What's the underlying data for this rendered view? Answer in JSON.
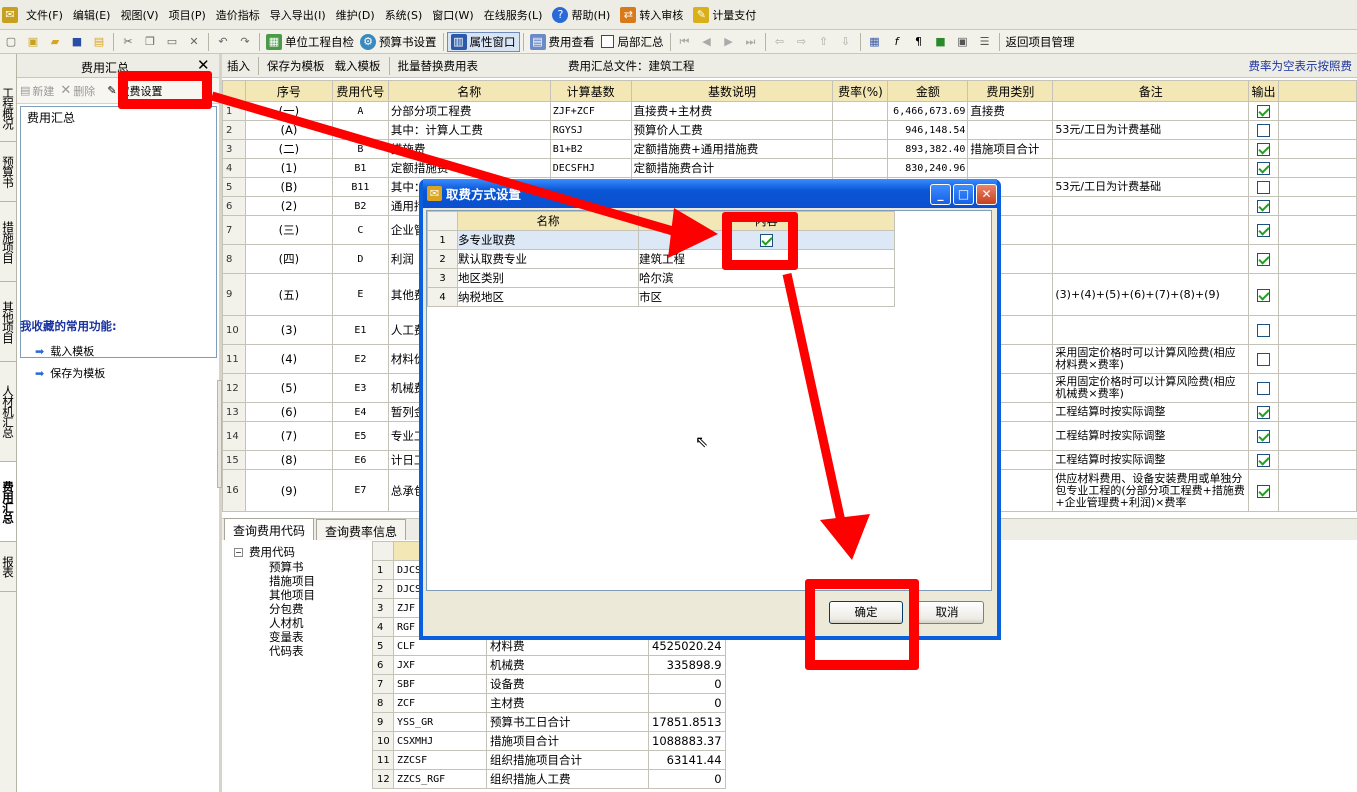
{
  "menubar": {
    "items": [
      "文件(F)",
      "编辑(E)",
      "视图(V)",
      "项目(P)",
      "造价指标",
      "导入导出(I)",
      "维护(D)",
      "系统(S)",
      "窗口(W)",
      "在线服务(L)",
      "帮助(H)",
      "转入审核",
      "计量支付"
    ]
  },
  "toolbar": {
    "unit_check": "单位工程自检",
    "budget_settings": "预算书设置",
    "property_window": "属性窗口",
    "fee_view": "费用查看",
    "partial_summary": "局部汇总",
    "back_to_project": "返回项目管理"
  },
  "vtabs": [
    "工程概况",
    "预算书",
    "措施项目",
    "其他项目",
    "人材机汇总",
    "费用汇总",
    "报表"
  ],
  "left_panel": {
    "title": "费用汇总",
    "new": "新建",
    "delete": "删除",
    "fee_setting": "取费设置",
    "tree_item": "费用汇总",
    "favorites_title": "我收藏的常用功能:",
    "favorites": [
      "载入模板",
      "保存为模板"
    ]
  },
  "main_toolbar": {
    "insert": "插入",
    "save_template": "保存为模板",
    "load_template": "载入模板",
    "batch_replace": "批量替换费用表",
    "summary_file": "费用汇总文件：建筑工程",
    "rate_hint": "费率为空表示按照费"
  },
  "grid": {
    "headers": [
      "序号",
      "费用代号",
      "名称",
      "计算基数",
      "基数说明",
      "费率(%)",
      "金额",
      "费用类别",
      "备注",
      "输出"
    ],
    "rows": [
      {
        "n": "1",
        "seq": "(一)",
        "code": "A",
        "name": "分部分项工程费",
        "base": "ZJF+ZCF",
        "desc": "直接费+主材费",
        "rate": "",
        "amount": "6,466,673.69",
        "cat": "直接费",
        "note": "",
        "out": true
      },
      {
        "n": "2",
        "seq": "(A)",
        "code": "",
        "name": "其中：计算人工费",
        "base": "RGYSJ",
        "desc": "预算价人工费",
        "rate": "",
        "amount": "946,148.54",
        "cat": "",
        "note": "53元/工日为计费基础",
        "out": false
      },
      {
        "n": "3",
        "seq": "(二)",
        "code": "B",
        "name": "措施费",
        "base": "B1+B2",
        "desc": "定额措施费+通用措施费",
        "rate": "",
        "amount": "893,382.40",
        "cat": "措施项目合计",
        "note": "",
        "out": true
      },
      {
        "n": "4",
        "seq": "(1)",
        "code": "B1",
        "name": "定额措施费",
        "base": "DECSFHJ",
        "desc": "定额措施费合计",
        "rate": "",
        "amount": "830,240.96",
        "cat": "",
        "note": "",
        "out": true
      },
      {
        "n": "5",
        "seq": "(B)",
        "code": "B11",
        "name": "其中：计算",
        "base": "",
        "desc": "",
        "rate": "",
        "amount": "",
        "cat": "",
        "note": "53元/工日为计费基础",
        "out": false
      },
      {
        "n": "6",
        "seq": "(2)",
        "code": "B2",
        "name": "通用措施费",
        "base": "",
        "desc": "",
        "rate": "",
        "amount": "",
        "cat": "",
        "note": "",
        "out": true
      },
      {
        "n": "7",
        "seq": "(三)",
        "code": "C",
        "name": "企业管理费",
        "base": "",
        "desc": "",
        "rate": "",
        "amount": "",
        "cat": "",
        "note": "",
        "out": true
      },
      {
        "n": "8",
        "seq": "(四)",
        "code": "D",
        "name": "利润",
        "base": "",
        "desc": "",
        "rate": "",
        "amount": "",
        "cat": "",
        "note": "",
        "out": true
      },
      {
        "n": "9",
        "seq": "(五)",
        "code": "E",
        "name": "其他费用",
        "base": "",
        "desc": "",
        "rate": "",
        "amount": "",
        "cat": "",
        "note": "(3)+(4)+(5)+(6)+(7)+(8)+(9)",
        "out": true
      },
      {
        "n": "10",
        "seq": "(3)",
        "code": "E1",
        "name": "人工费价差",
        "base": "",
        "desc": "",
        "rate": "",
        "amount": "",
        "cat": "",
        "note": "",
        "out": false
      },
      {
        "n": "11",
        "seq": "(4)",
        "code": "E2",
        "name": "材料价差",
        "base": "",
        "desc": "",
        "rate": "",
        "amount": "",
        "cat": "",
        "note": "采用固定价格时可以计算风险费(相应材料费×费率)",
        "out": false
      },
      {
        "n": "12",
        "seq": "(5)",
        "code": "E3",
        "name": "机械费价差",
        "base": "",
        "desc": "",
        "rate": "",
        "amount": "",
        "cat": "",
        "note": "采用固定价格时可以计算风险费(相应机械费×费率)",
        "out": false
      },
      {
        "n": "13",
        "seq": "(6)",
        "code": "E4",
        "name": "暂列金额",
        "base": "",
        "desc": "",
        "rate": "",
        "amount": "",
        "cat": "",
        "note": "工程结算时按实际调整",
        "out": true
      },
      {
        "n": "14",
        "seq": "(7)",
        "code": "E5",
        "name": "专业工程暂估价",
        "base": "",
        "desc": "",
        "rate": "",
        "amount": "",
        "cat": "",
        "note": "工程结算时按实际调整",
        "out": true
      },
      {
        "n": "15",
        "seq": "(8)",
        "code": "E6",
        "name": "计日工",
        "base": "",
        "desc": "",
        "rate": "",
        "amount": "",
        "cat": "",
        "note": "工程结算时按实际调整",
        "out": true
      },
      {
        "n": "16",
        "seq": "(9)",
        "code": "E7",
        "name": "总承包服务费",
        "base": "",
        "desc": "",
        "rate": "",
        "amount": "",
        "cat": "",
        "note": "供应材料费用、设备安装费用或单独分包专业工程的(分部分项工程费+措施费+企业管理费+利润)×费率",
        "out": true
      }
    ]
  },
  "bottom_tabs": [
    "查询费用代码",
    "查询费率信息"
  ],
  "code_tree": {
    "root": "费用代码",
    "children": [
      "预算书",
      "措施项目",
      "其他项目",
      "分包费",
      "人材机",
      "变量表",
      "代码表"
    ]
  },
  "code_grid": {
    "rows": [
      {
        "n": "1",
        "code": "DJCS",
        "name": "",
        "value": ""
      },
      {
        "n": "2",
        "code": "DJCS",
        "name": "",
        "value": ""
      },
      {
        "n": "3",
        "code": "ZJF",
        "name": "",
        "value": ""
      },
      {
        "n": "4",
        "code": "RGF",
        "name": "",
        "value": ""
      },
      {
        "n": "5",
        "code": "CLF",
        "name": "材料费",
        "value": "4525020.24"
      },
      {
        "n": "6",
        "code": "JXF",
        "name": "机械费",
        "value": "335898.9"
      },
      {
        "n": "7",
        "code": "SBF",
        "name": "设备费",
        "value": "0"
      },
      {
        "n": "8",
        "code": "ZCF",
        "name": "主材费",
        "value": "0"
      },
      {
        "n": "9",
        "code": "YSS_GR",
        "name": "预算书工日合计",
        "value": "17851.8513"
      },
      {
        "n": "10",
        "code": "CSXMHJ",
        "name": "措施项目合计",
        "value": "1088883.37"
      },
      {
        "n": "11",
        "code": "ZZCSF",
        "name": "组织措施项目合计",
        "value": "63141.44"
      },
      {
        "n": "12",
        "code": "ZZCS_RGF",
        "name": "组织措施人工费",
        "value": "0"
      }
    ]
  },
  "dialog": {
    "title": "取费方式设置",
    "headers": [
      "名称",
      "内容"
    ],
    "rows": [
      {
        "n": "1",
        "name": "多专业取费",
        "value": "",
        "checked": true
      },
      {
        "n": "2",
        "name": "默认取费专业",
        "value": "建筑工程"
      },
      {
        "n": "3",
        "name": "地区类别",
        "value": "哈尔滨"
      },
      {
        "n": "4",
        "name": "纳税地区",
        "value": "市区"
      }
    ],
    "ok": "确定",
    "cancel": "取消"
  },
  "colors": {
    "annotation": "#ff0000",
    "header": "#f4e7b6",
    "title_bar": "#0a5fdc"
  }
}
